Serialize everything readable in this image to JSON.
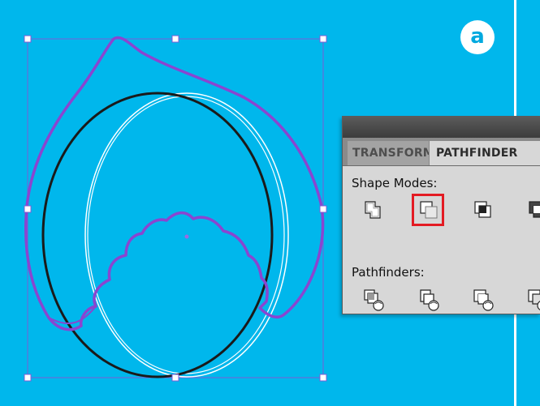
{
  "badge": {
    "label": "a"
  },
  "panel": {
    "tabs": [
      {
        "label": "TRANSFORM",
        "active": false
      },
      {
        "label": "PATHFINDER",
        "active": true
      }
    ],
    "shape_modes_label": "Shape Modes:",
    "pathfinders_label": "Pathfinders:",
    "shape_mode_icons": [
      "unite-icon",
      "minus-front-icon",
      "intersect-icon",
      "exclude-icon"
    ],
    "pathfinder_icons": [
      "divide-icon",
      "trim-icon",
      "merge-icon",
      "crop-icon"
    ],
    "highlighted_icon": "minus-front-icon"
  },
  "colors": {
    "canvas_background": "#00b7ec",
    "selection_box": "#7b5cd6",
    "purple_path": "#8a45d0",
    "black_path": "#1a1a1a",
    "white_path": "#ffffff",
    "highlight": "#e31b23",
    "panel_background": "#d7d7d7"
  }
}
